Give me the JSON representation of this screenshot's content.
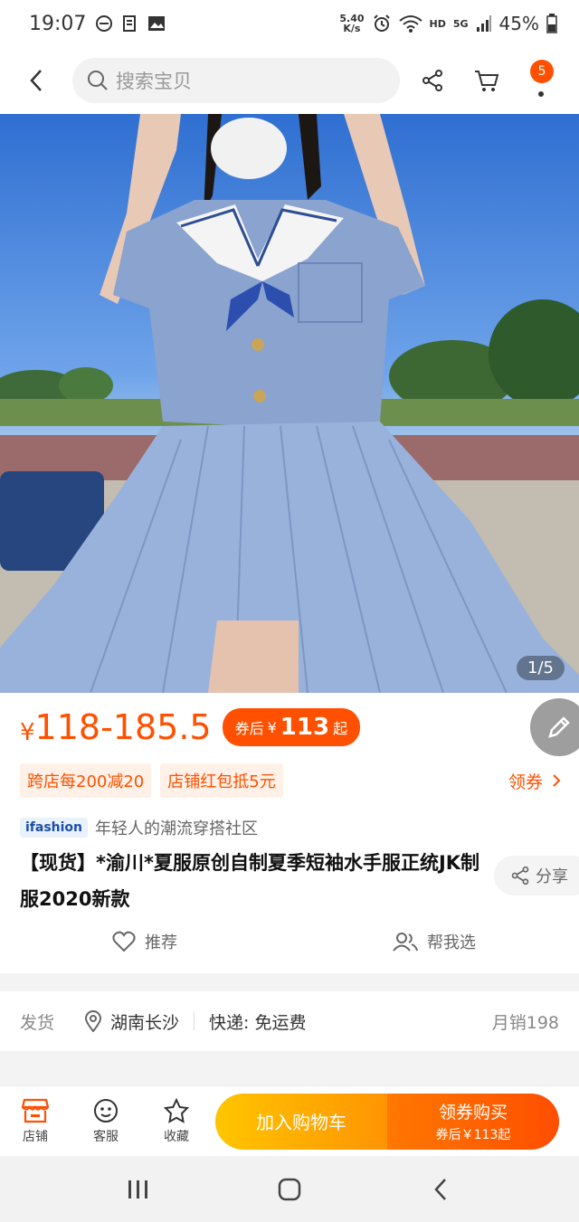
{
  "status_bar": {
    "time": "19:07",
    "net_speed_top": "5.40",
    "net_speed_bottom": "K/s",
    "hd": "HD",
    "network": "5G",
    "battery": "45%"
  },
  "header": {
    "search_placeholder": "搜索宝贝",
    "cart_badge": "5"
  },
  "product": {
    "image_counter": "1/5",
    "currency": "¥",
    "price_range": "118-185.5",
    "coupon_label": "券后",
    "coupon_currency": "¥",
    "coupon_price": "113",
    "coupon_suffix": "起",
    "promos": [
      "跨店每200减20",
      "店铺红包抵5元"
    ],
    "coupon_link": "领券",
    "brand_logo": "ifashion",
    "brand_slogan": "年轻人的潮流穿搭社区",
    "title": "【现货】*渝川*夏服原创自制夏季短袖水手服正统JK制服2020新款",
    "share": "分享",
    "recommend": "推荐",
    "help_choose": "帮我选"
  },
  "shipping": {
    "label": "发货",
    "location": "湖南长沙",
    "express": "快递: 免运费",
    "monthly_sales": "月销198"
  },
  "bottom_bar": {
    "shop": "店铺",
    "service": "客服",
    "favorite": "收藏",
    "add_to_cart": "加入购物车",
    "buy_with_coupon": "领券购买",
    "buy_sub": "券后￥113起"
  },
  "colors": {
    "accent": "#ff5000",
    "cart_gradient_start": "#ffc500",
    "buy_gradient_end": "#ff4e00"
  }
}
